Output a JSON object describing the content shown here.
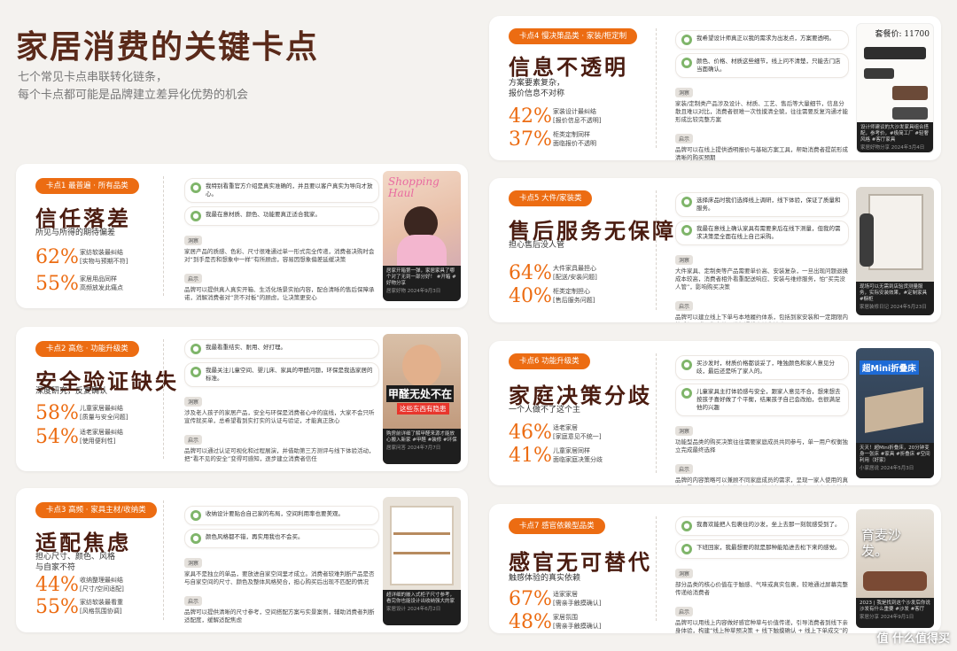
{
  "title": "家居消费的关键卡点",
  "subtitle_lines": [
    "七个常见卡点串联转化链条，",
    "每个卡点都可能是品牌建立差异化优势的机会"
  ],
  "label_insight": "洞察",
  "label_hint": "启示",
  "cards": [
    {
      "badge": "卡点1  最普遍 · 所有品类",
      "title": "信任落差",
      "subtitle": "所见与所得的期待偏差",
      "stats": [
        {
          "pct": "62%",
          "l1": "家纺软装最纠结",
          "l2": "[实物与预期不符]"
        },
        {
          "pct": "55%",
          "l2": "家居用品同样",
          "l3": "高频放发此痛点"
        }
      ],
      "quotes": [
        "我特别看重官方介绍是真实准确的，并且要以客户真实为导向才放心。",
        "我最在意材质、颜色、功能要真正适合我家。"
      ],
      "insight": "家居产品的质感、色彩、尺寸很难通过单一形式完全传递，消费者决购时会对“到手是否和想象中一样”有所顾虑，容易因想象偏差延缓决策",
      "hint": "品牌可以提供真人真实开箱、生活化场景实拍内容，配合清晰的售后保障承诺，消解消费者对“货不对板”的顾虑，让决策更安心",
      "photo_title": "Shopping Haul",
      "photo_caption": "居家开箱第一弹，家居家具了哪个对了无到一部分好！ #开箱 #好物分享",
      "photo_meta": "居家好物  2024年9月3日"
    },
    {
      "badge": "卡点2  高危 · 功能升级类",
      "title": "安全验证缺失",
      "subtitle": "深度研究，反复确认",
      "stats": [
        {
          "pct": "58%",
          "l1": "儿童家居最纠结",
          "l2": "[质量与安全问题]"
        },
        {
          "pct": "54%",
          "l1": "适老家居最纠结",
          "l2": "[使用便利性]"
        }
      ],
      "quotes": [
        "我最看重结实、耐用、好打理。",
        "我最关注儿童空间、婴儿床、家具的甲醛问题，环保是我选家居的标准。"
      ],
      "insight": "涉及老人孩子的家居产品，安全与环保是消费者心中的底线，大家不会只听宣传就买单，总希望看到实打实的认证与验证，才能真正放心",
      "hint": "品牌可以通过认证可视化和过程展演，并借助第三方测评与线下体验活动，把“看不见的安全”变得可感知，逐步建立消费者信任",
      "photo_title": "甲醛无处不在",
      "photo_sub": "这些东西有隐患",
      "photo_caption": "购房前详细了解甲醛来源才能放心搬入新家 #甲醛 #装修 #环保",
      "photo_meta": "居家问答  2024年7月7日"
    },
    {
      "badge": "卡点3  高频 · 家具主材/收纳类",
      "title": "适配焦虑",
      "subtitle": "担心尺寸、颜色、风格\n与自家不符",
      "stats": [
        {
          "pct": "44%",
          "l1": "收纳整理最纠结",
          "l2": "[尺寸/空间适配]"
        },
        {
          "pct": "55%",
          "l1": "家纺软装最看重",
          "l2": "[风格氛围协调]"
        }
      ],
      "quotes": [
        "收纳设计要贴合自己家的布局，空间利用率也要美观。",
        "颜色风格都不错，再实用我也不会买。"
      ],
      "insight": "家具不是独立的单品，要放进自家空间里才成立。消费者较难判断产品是否与自家空间的尺寸、颜色及整体风格契合，担心购买后出现不匹配的情况",
      "hint": "品牌可以提供清晰的尺寸参考，空间搭配方案与实景案例，辅助消费者判断适配度，缓解适配焦虑",
      "photo_caption": "超详细的嵌入式柜子尺寸参考，看完你也能设计出收纳强大的家",
      "photo_meta": "家居设计  2024年6月2日"
    },
    {
      "badge": "卡点4  慢决策品类 · 家装/柜定制",
      "title": "信息不透明",
      "subtitle": "方案要素复杂，\n报价信息不对称",
      "stats": [
        {
          "pct": "42%",
          "l1": "家装设计最纠结",
          "l2": "[报价信息不透明]"
        },
        {
          "pct": "37%",
          "l1": "柜类定制同样",
          "l2": "面临报价不透明"
        }
      ],
      "quotes": [
        "我希望设计师真正以我的需求为出发点，方案要透明。",
        "颜色、价格、材质这些细节，线上问不清楚，只能去门店当面确认。"
      ],
      "insight": "家装/定制类产品涉及设计、材质、工艺、售后等大量细节，信息分散且难以对比，消费者很难一次性摸清全貌，往往需要反复沟通才能形成比较完整方案",
      "hint": "品牌可以在线上提供透明报价与基础方案工具，帮助消费者提前形成清晰的购买预期",
      "photo_price": "套餐价: 11700",
      "photo_caption": "设计师建议的大沙发家具组合搭配，参考价，#极简工厂 #轻奢风格 #客厅家具",
      "photo_meta": "家居好物分享  2024年3月4日"
    },
    {
      "badge": "卡点5  大件/家装类",
      "title": "售后服务无保障",
      "subtitle": "担心售后没人管",
      "stats": [
        {
          "pct": "64%",
          "l1": "大件家具最担心",
          "l2": "[配送/安装问题]"
        },
        {
          "pct": "40%",
          "l1": "柜类定制担心",
          "l2": "[售后服务问题]"
        }
      ],
      "quotes": [
        "选择床品时我们选择线上调研，线下体验，保证了质量和服务。",
        "我最在意线上确认家具有需要来后在线下测量，但我的需求决策是全面在线上自己采购。"
      ],
      "insight": "大件家具、定制类等产品需要单价高、安装复杂，一旦出现问题退换成本较高，消费者相外看重配送响应、安装与维修服务，怕“买完没人管”，影响购买决策",
      "hint": "品牌可以建立线上下单与本地履约体系，包括到家安装和一定期限内的质保承诺，为大件品类打通线上转化链路",
      "photo_caption": "现场可以无需到店验货测量服务，实际安装效果，#定制家具 #橱柜",
      "photo_meta": "家居装修日记  2024年5月23日"
    },
    {
      "badge": "卡点6  功能升级类",
      "title": "家庭决策分歧",
      "subtitle": "一个人做不了这个主",
      "stats": [
        {
          "pct": "46%",
          "l1": "适老家居",
          "l2": "[家庭意见不统一]"
        },
        {
          "pct": "41%",
          "l1": "儿童家居同样",
          "l2": "面临家庭决策分歧"
        }
      ],
      "quotes": [
        "买沙发时，材质价格都谈妥了，唯独颜色和家人意见分歧，最后还是听了家人的。",
        "儿童家具主打体验感与安全，跟家人意见不合，想来想去按孩子喜好做了个平衡，结果孩子自己会改拍，也很满足他的兴趣"
      ],
      "insight": "功能型品类的购买决策往往需要家庭成员共同参与，单一用户权衡独立完成最终选择",
      "hint": "品牌的内容策略可以兼顾不同家庭成员的需求，呈现一家人使用的真实场景，让不同角色都能在内容里找到自己在意的点，助力家庭快速达成共识",
      "photo_title": "超Mini折叠床",
      "photo_caption": "天天！超Mini折叠床，20分钟变身一张床 #家具 #折叠床 #空间利用（好家）",
      "photo_meta": "小家居说  2024年5月3日"
    },
    {
      "badge": "卡点7  感官依赖型品类",
      "title": "感官无可替代",
      "subtitle": "触感体验的真实依赖",
      "stats": [
        {
          "pct": "67%",
          "l1": "适家家居",
          "l2": "[需亲手触摸确认]"
        },
        {
          "pct": "48%",
          "l1": "家居氛围",
          "l2": "[需亲手触摸确认]"
        }
      ],
      "quotes": [
        "我喜欢能把人包裹住的沙发，坐上去那一刻就感受到了。",
        "下班回家，我最想要的就是那种能陷进去松下来的感觉。"
      ],
      "insight": "部分品类的核心价值在于触感、气味或真实包裹，较难通过屏幕完整传递给消费者",
      "hint": "品牌可以用线上内容做好感官种草与价值传递，引导消费者到线下亲身体验，构建“线上种草预决策 + 线下触摸确认 + 线上下单成交”的完整链路，兼顾种草效率与体验需求",
      "photo_title": "育麦沙发。",
      "photo_caption": "2023 | 我是找到这个沙发后你说沙发有什么重要 #沙发 #客厅",
      "photo_meta": "家居分享  2024年9月1日",
      "watermark": "值 什么值得买"
    }
  ]
}
